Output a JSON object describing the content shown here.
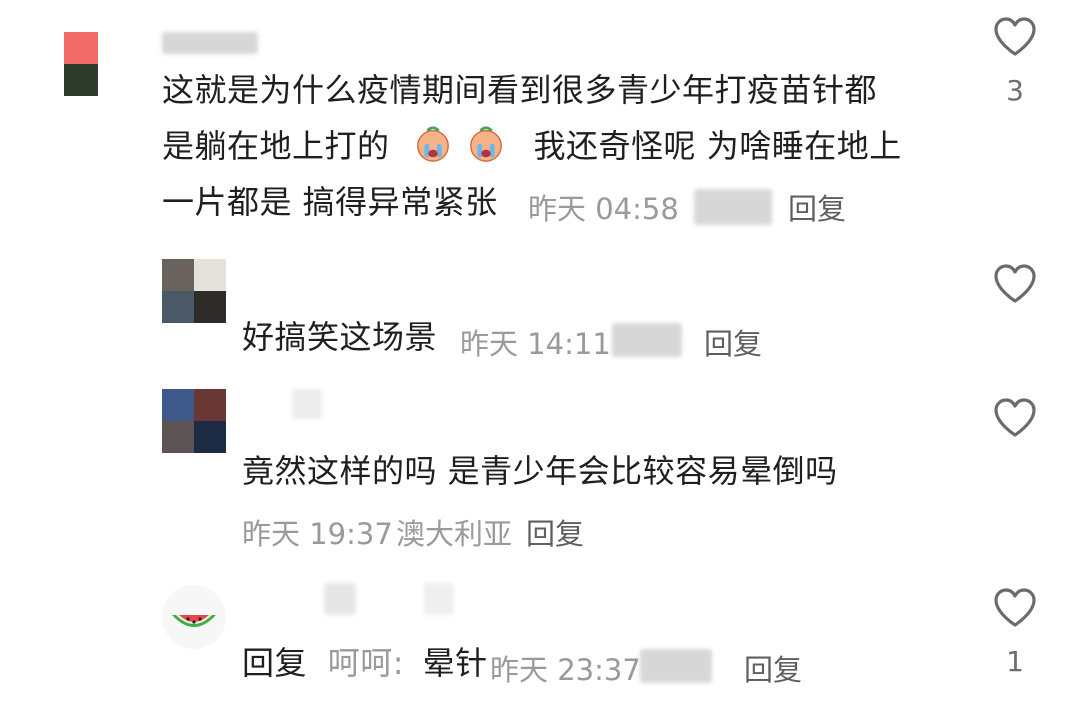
{
  "comments": [
    {
      "line1": "这就是为什么疫情期间看到很多青少年打疫苗针都",
      "line2_a": "是躺在地上打的",
      "line2_b": "我还奇怪呢  为啥睡在地上",
      "line3": "一片都是  搞得异常紧张",
      "time": "昨天 04:58",
      "reply": "回复",
      "likes": "3"
    },
    {
      "text": "好搞笑这场景",
      "time": "昨天 14:11",
      "reply": "回复"
    },
    {
      "text": "竟然这样的吗 是青少年会比较容易晕倒吗",
      "time": "昨天 19:37",
      "location": "澳大利亚",
      "reply": "回复"
    },
    {
      "prefix": "回复",
      "quoted": "呵呵:",
      "text": "晕针",
      "time": "昨天 23:37",
      "reply": "回复",
      "likes": "1"
    }
  ],
  "icons": {
    "like": "heart-outline-icon",
    "emoji": "crying-face-emoji",
    "avatar4": "watermelon-icon"
  },
  "colors": {
    "text": "#1f1f1f",
    "meta": "#9a9a9a",
    "icon": "#6b6b6b"
  }
}
